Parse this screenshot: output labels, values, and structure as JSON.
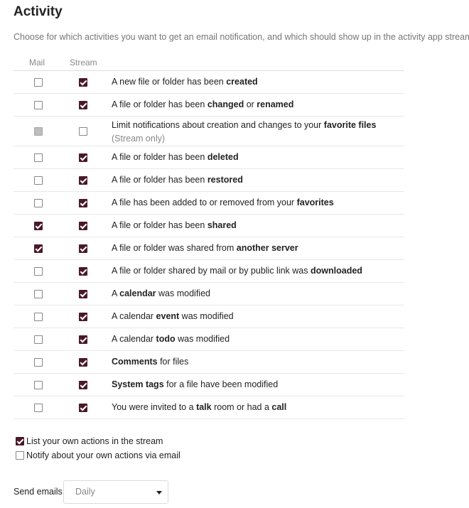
{
  "section": {
    "title": "Activity",
    "description": "Choose for which activities you want to get an email notification, and which should show up in the activity app stream."
  },
  "table": {
    "headers": {
      "mail": "Mail",
      "stream": "Stream"
    },
    "rows": [
      {
        "mail": false,
        "stream": true,
        "parts": [
          [
            "A new file or folder has been ",
            false
          ],
          [
            "created",
            true
          ]
        ]
      },
      {
        "mail": false,
        "stream": true,
        "parts": [
          [
            "A file or folder has been ",
            false
          ],
          [
            "changed",
            true
          ],
          [
            " or ",
            false
          ],
          [
            "renamed",
            true
          ]
        ]
      },
      {
        "mail": "disabled",
        "stream": false,
        "tall": true,
        "parts": [
          [
            "Limit notifications about creation and changes to your ",
            false
          ],
          [
            "favorite files",
            true
          ]
        ],
        "sub": "(Stream only)"
      },
      {
        "mail": false,
        "stream": true,
        "parts": [
          [
            "A file or folder has been ",
            false
          ],
          [
            "deleted",
            true
          ]
        ]
      },
      {
        "mail": false,
        "stream": true,
        "parts": [
          [
            "A file or folder has been ",
            false
          ],
          [
            "restored",
            true
          ]
        ]
      },
      {
        "mail": false,
        "stream": true,
        "parts": [
          [
            "A file has been added to or removed from your ",
            false
          ],
          [
            "favorites",
            true
          ]
        ]
      },
      {
        "mail": true,
        "stream": true,
        "parts": [
          [
            "A file or folder has been ",
            false
          ],
          [
            "shared",
            true
          ]
        ]
      },
      {
        "mail": true,
        "stream": true,
        "parts": [
          [
            "A file or folder was shared from ",
            false
          ],
          [
            "another server",
            true
          ]
        ]
      },
      {
        "mail": false,
        "stream": true,
        "parts": [
          [
            "A file or folder shared by mail or by public link was ",
            false
          ],
          [
            "downloaded",
            true
          ]
        ]
      },
      {
        "mail": false,
        "stream": true,
        "parts": [
          [
            "A ",
            false
          ],
          [
            "calendar",
            true
          ],
          [
            " was modified",
            false
          ]
        ]
      },
      {
        "mail": false,
        "stream": true,
        "parts": [
          [
            "A calendar ",
            false
          ],
          [
            "event",
            true
          ],
          [
            " was modified",
            false
          ]
        ]
      },
      {
        "mail": false,
        "stream": true,
        "parts": [
          [
            "A calendar ",
            false
          ],
          [
            "todo",
            true
          ],
          [
            " was modified",
            false
          ]
        ]
      },
      {
        "mail": false,
        "stream": true,
        "parts": [
          [
            "Comments",
            true
          ],
          [
            " for files",
            false
          ]
        ]
      },
      {
        "mail": false,
        "stream": true,
        "parts": [
          [
            "System tags",
            true
          ],
          [
            " for a file have been modified",
            false
          ]
        ]
      },
      {
        "mail": false,
        "stream": true,
        "parts": [
          [
            "You were invited to a ",
            false
          ],
          [
            "talk",
            true
          ],
          [
            " room or had a ",
            false
          ],
          [
            "call",
            true
          ]
        ]
      }
    ]
  },
  "options": {
    "list_own_actions": {
      "label": "List your own actions in the stream",
      "checked": true
    },
    "notify_own_actions": {
      "label": "Notify about your own actions via email",
      "checked": false
    }
  },
  "send_emails": {
    "label": "Send emails:",
    "value": "Daily"
  },
  "colors": {
    "checkbox_checked": "#4a1927",
    "checkbox_disabled": "#bdbdbd"
  }
}
